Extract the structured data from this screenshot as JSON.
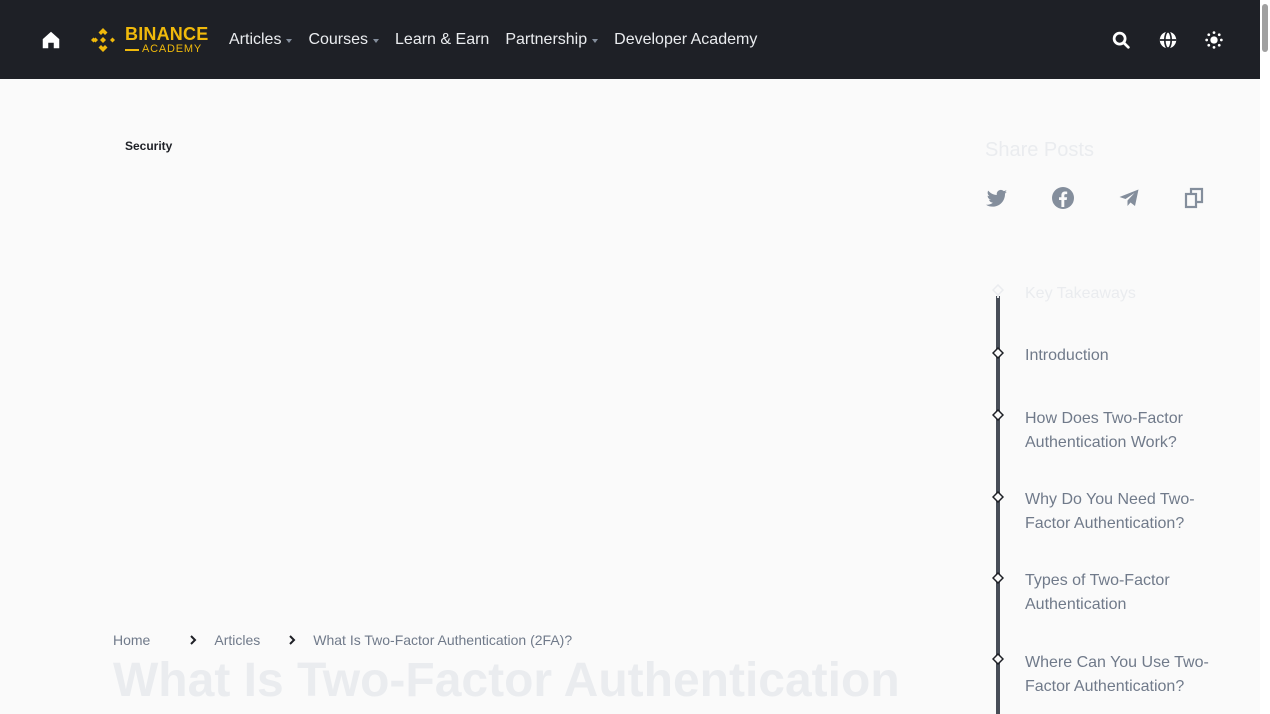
{
  "header": {
    "logo": {
      "brand": "BINANCE",
      "sub": "ACADEMY"
    },
    "nav": [
      {
        "label": "Articles",
        "has_dropdown": true
      },
      {
        "label": "Courses",
        "has_dropdown": true
      },
      {
        "label": "Learn & Earn",
        "has_dropdown": false
      },
      {
        "label": "Partnership",
        "has_dropdown": true
      },
      {
        "label": "Developer Academy",
        "has_dropdown": false
      }
    ],
    "icons": [
      "search-icon",
      "globe-icon",
      "theme-toggle-icon"
    ]
  },
  "article": {
    "tag": "Security",
    "breadcrumb": {
      "home": "Home",
      "articles": "Articles",
      "current": "What Is Two-Factor Authentication (2FA)?"
    },
    "title": "What Is Two-Factor Authentication"
  },
  "sidebar": {
    "share_title": "Share Posts",
    "share_icons": [
      "twitter-icon",
      "facebook-icon",
      "telegram-icon",
      "copy-link-icon"
    ],
    "toc": [
      "Key Takeaways",
      "Introduction",
      "How Does Two-Factor Authentication Work?",
      "Why Do You Need Two-Factor Authentication?",
      "Types of Two-Factor Authentication",
      "Where Can You Use Two-Factor Authentication?"
    ]
  },
  "colors": {
    "header_bg": "#1e2026",
    "brand": "#f0b90b",
    "page_bg": "#fafafa",
    "muted_text": "#707a8a",
    "faded_text": "#eaecef"
  }
}
